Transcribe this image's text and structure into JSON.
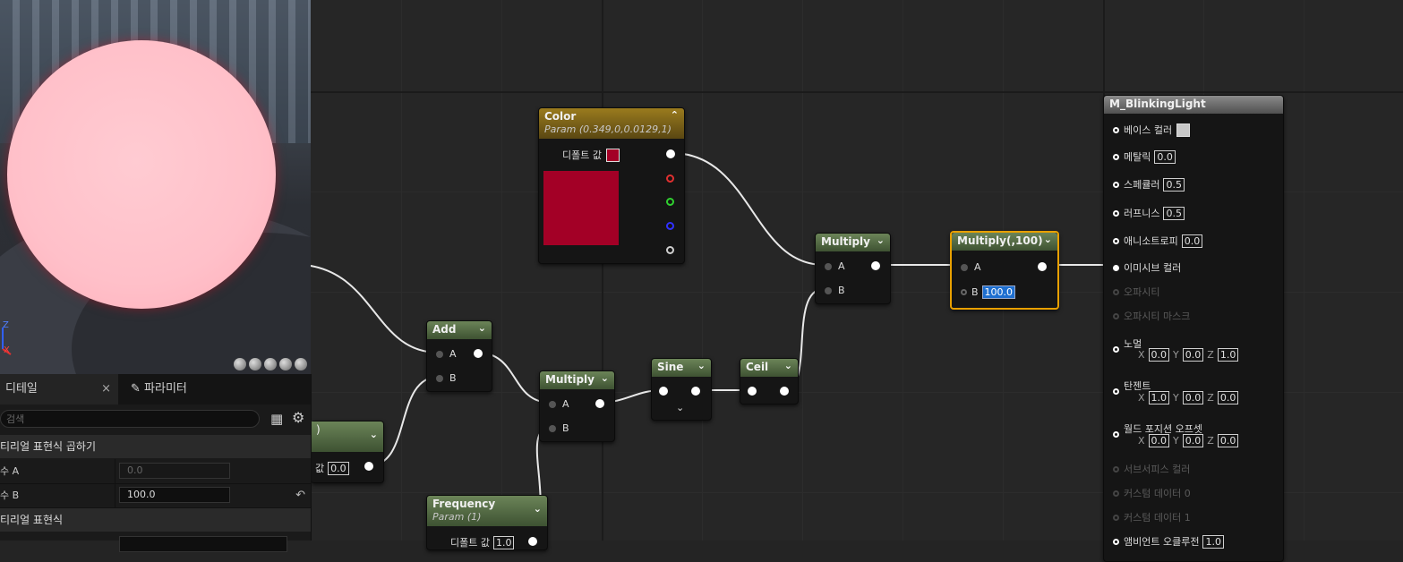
{
  "graph": {
    "color_node": {
      "title": "Color",
      "subtitle": "Param (0.349,0,0.0129,1)",
      "default_label": "디폴트 값",
      "swatch_color": "#a30026"
    },
    "add_node": {
      "title": "Add",
      "pin_a": "A",
      "pin_b": "B"
    },
    "multiply1": {
      "title": "Multiply",
      "pin_a": "A",
      "pin_b": "B"
    },
    "sine_node": {
      "title": "Sine"
    },
    "ceil_node": {
      "title": "Ceil"
    },
    "multiply2": {
      "title": "Multiply",
      "pin_a": "A",
      "pin_b": "B"
    },
    "multiply3": {
      "title": "Multiply(,100)",
      "pin_a": "A",
      "pin_b": "B",
      "b_value": "100.0"
    },
    "frequency_node": {
      "title": "Frequency",
      "subtitle": "Param (1)",
      "default_label": "디폴트 값",
      "default_value": "1.0"
    },
    "partial_node": {
      "title": ")",
      "default_label": "값",
      "default_value": "0.0"
    },
    "result_node": {
      "title": "M_BlinkingLight",
      "pins": {
        "base_color": "베이스 컬러",
        "metallic": "메탈릭",
        "metallic_val": "0.0",
        "specular": "스페큘러",
        "specular_val": "0.5",
        "roughness": "러프니스",
        "roughness_val": "0.5",
        "anisotropy": "애니소트로피",
        "anisotropy_val": "0.0",
        "emissive": "이미시브 컬러",
        "opacity": "오파시티",
        "opacity_mask": "오파시티 마스크",
        "normal": "노멀",
        "normal_x": "0.0",
        "normal_y": "0.0",
        "normal_z": "1.0",
        "tangent": "탄젠트",
        "tangent_x": "1.0",
        "tangent_y": "0.0",
        "tangent_z": "0.0",
        "wpo": "월드 포지션 오프셋",
        "wpo_x": "0.0",
        "wpo_y": "0.0",
        "wpo_z": "0.0",
        "subsurface": "서브서피스 컬러",
        "custom0": "커스텀 데이터 0",
        "custom1": "커스텀 데이터 1",
        "ao": "앰비언트 오클루전",
        "ao_val": "1.0"
      },
      "axis_x": "X",
      "axis_y": "Y",
      "axis_z": "Z"
    }
  },
  "viewport": {
    "axis_z": "Z",
    "axis_x": "X"
  },
  "details": {
    "tab_details": "디테일",
    "tab_close": "×",
    "tab_params": "파라미터",
    "search_placeholder": "검색",
    "section1": "티리얼 표현식 곱하기",
    "row_a_label": "수 A",
    "row_a_value": "0.0",
    "row_b_label": "수 B",
    "row_b_value": "100.0",
    "section2": "티리얼 표현식"
  },
  "colors": {
    "accent_selected": "#e8a000",
    "emissive_swatch": "#a30026",
    "base_swatch": "#c8c8c8"
  }
}
